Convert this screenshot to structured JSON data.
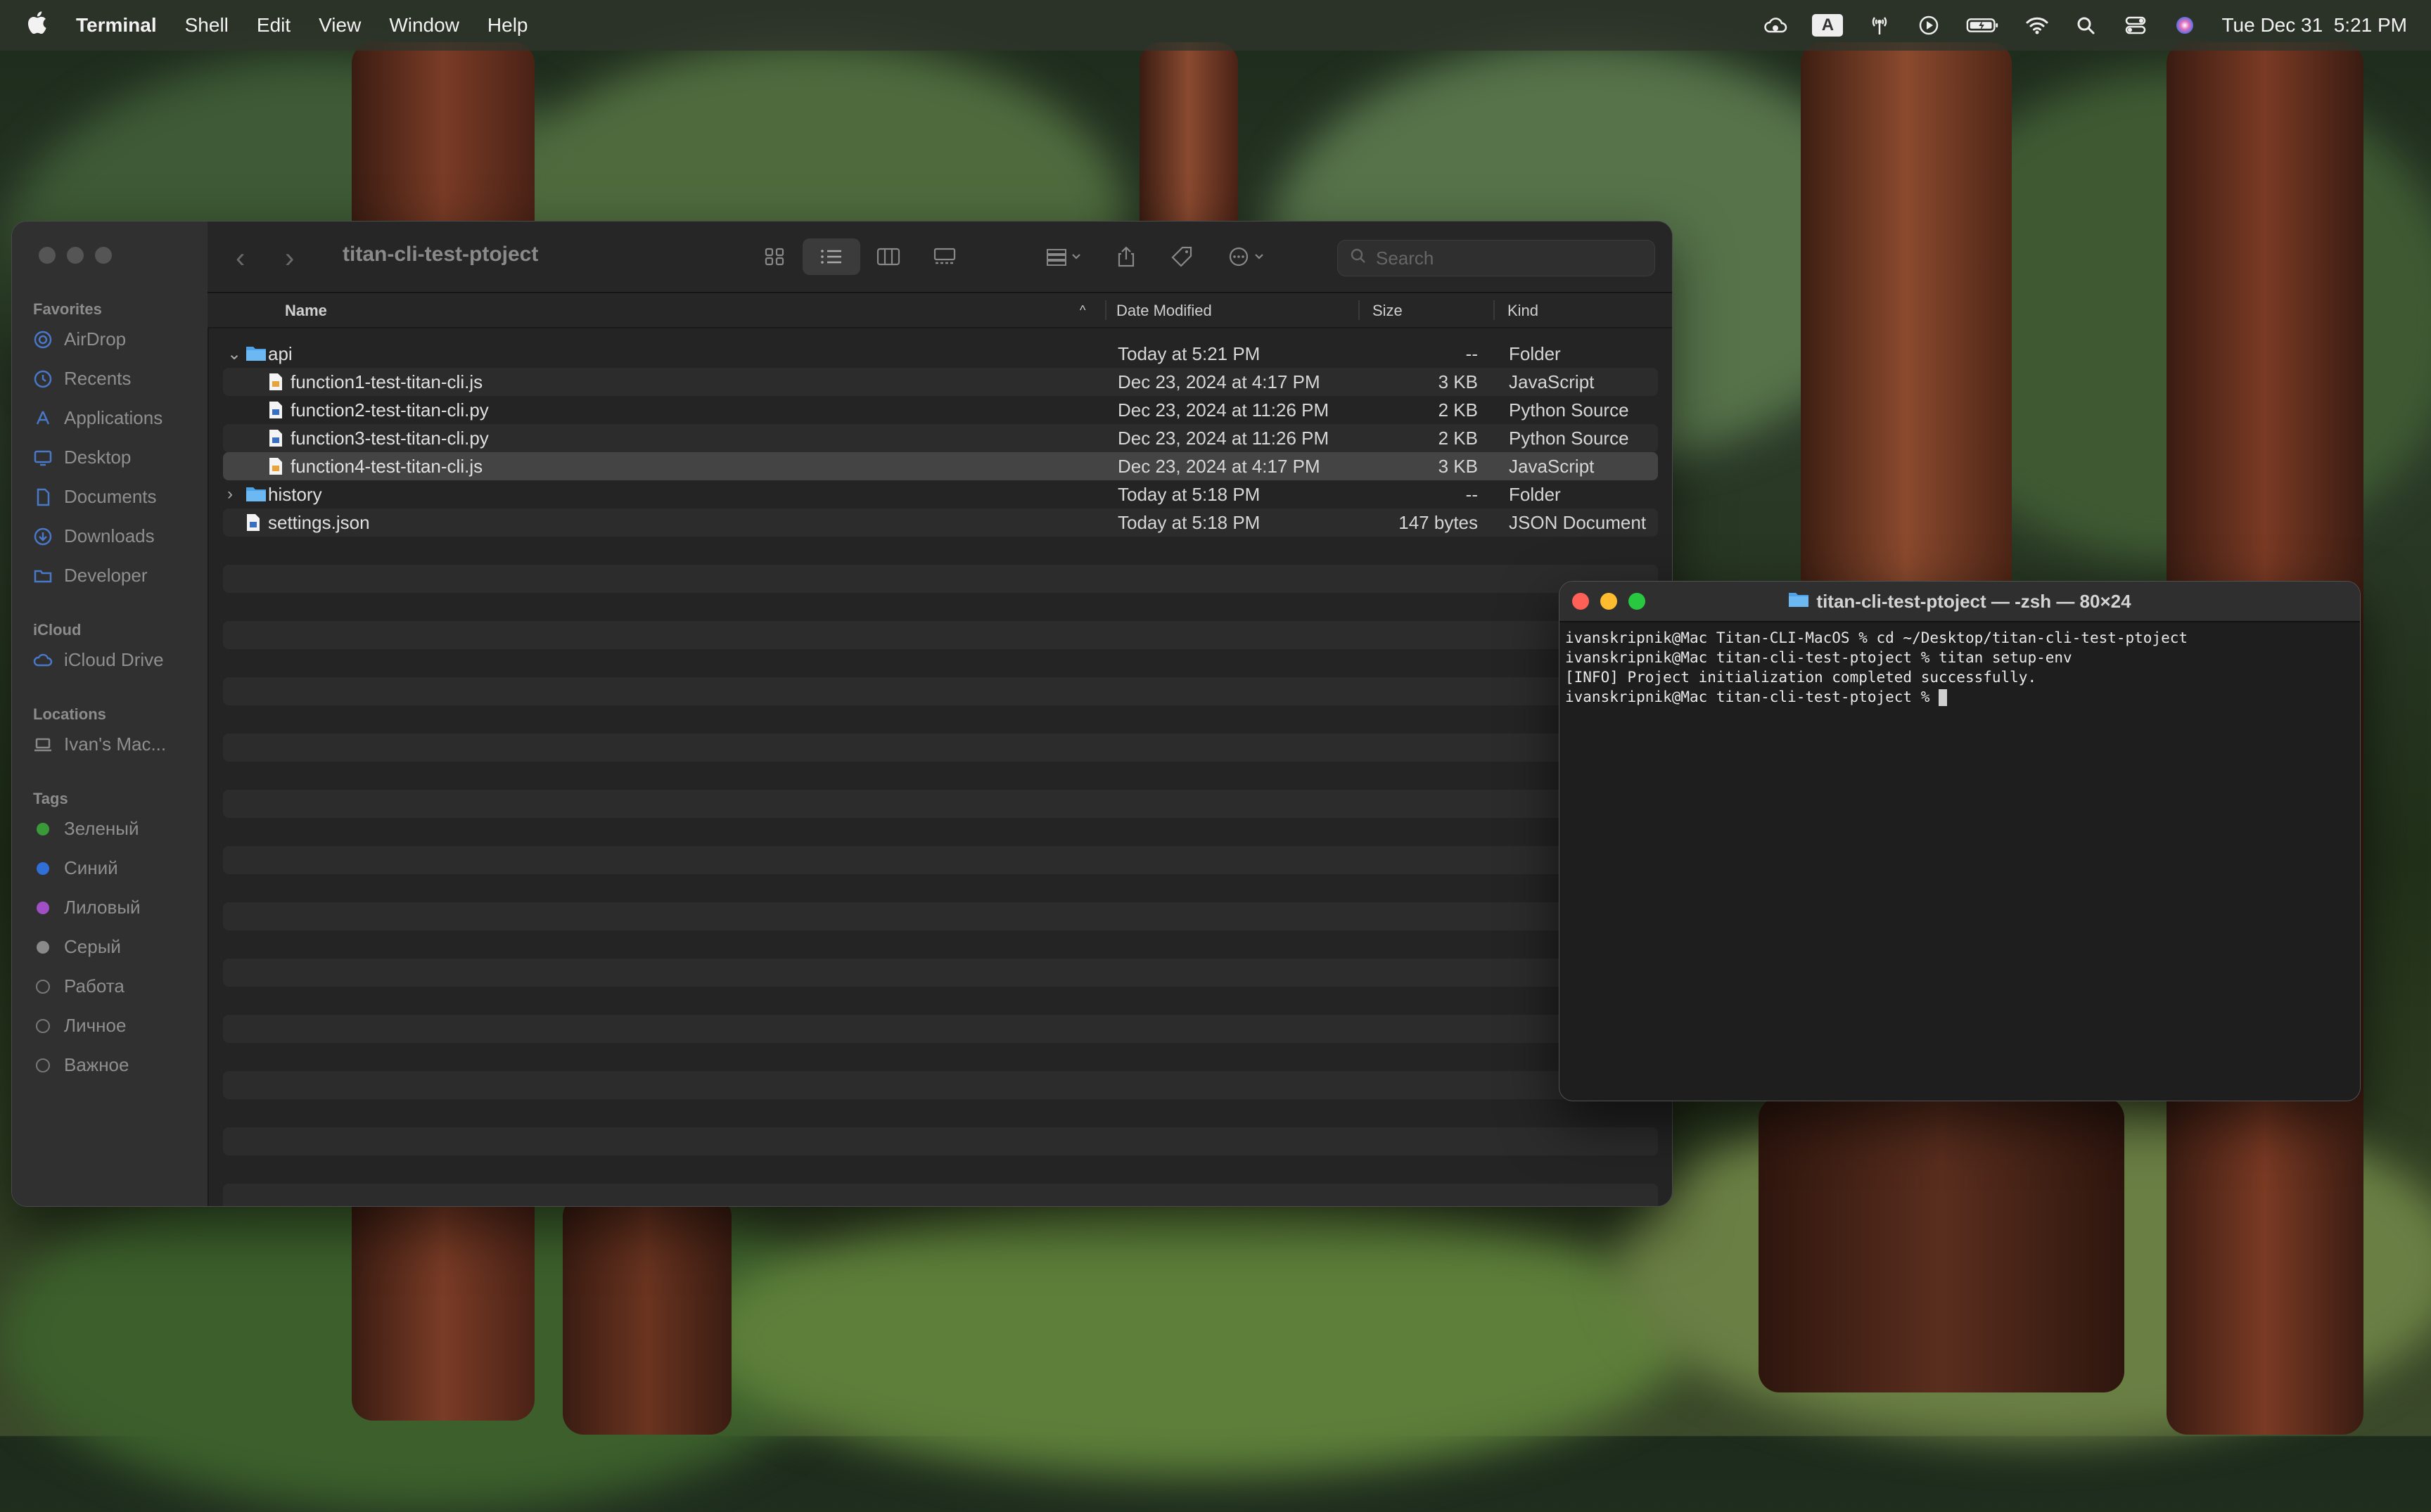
{
  "menubar": {
    "app_name": "Terminal",
    "menus": [
      "Shell",
      "Edit",
      "View",
      "Window",
      "Help"
    ],
    "input_source": "A",
    "clock": "Tue Dec 31  5:21 PM"
  },
  "finder": {
    "title": "titan-cli-test-ptoject",
    "search_placeholder": "Search",
    "sidebar": {
      "favorites_label": "Favorites",
      "favorites": [
        {
          "label": "AirDrop",
          "icon": "airdrop-icon"
        },
        {
          "label": "Recents",
          "icon": "clock-icon"
        },
        {
          "label": "Applications",
          "icon": "applications-icon"
        },
        {
          "label": "Desktop",
          "icon": "desktop-icon"
        },
        {
          "label": "Documents",
          "icon": "document-icon"
        },
        {
          "label": "Downloads",
          "icon": "download-icon"
        },
        {
          "label": "Developer",
          "icon": "folder-icon"
        }
      ],
      "icloud_label": "iCloud",
      "icloud": [
        {
          "label": "iCloud Drive",
          "icon": "cloud-icon"
        }
      ],
      "locations_label": "Locations",
      "locations": [
        {
          "label": "Ivan's Mac...",
          "icon": "laptop-icon"
        }
      ],
      "tags_label": "Tags",
      "tags": [
        {
          "label": "Зеленый",
          "color": "#3a9a3a"
        },
        {
          "label": "Синий",
          "color": "#2f6fd6"
        },
        {
          "label": "Лиловый",
          "color": "#a04fc4"
        },
        {
          "label": "Серый",
          "color": "#8a8a8a"
        },
        {
          "label": "Работа",
          "color": ""
        },
        {
          "label": "Личное",
          "color": ""
        },
        {
          "label": "Важное",
          "color": ""
        }
      ]
    },
    "columns": {
      "name": "Name",
      "date": "Date Modified",
      "size": "Size",
      "kind": "Kind"
    },
    "files": [
      {
        "name": "api",
        "date": "Today at 5:21 PM",
        "size": "--",
        "kind": "Folder",
        "type": "folder",
        "expanded": true,
        "depth": 0
      },
      {
        "name": "function1-test-titan-cli.js",
        "date": "Dec 23, 2024 at 4:17 PM",
        "size": "3 KB",
        "kind": "JavaScript",
        "type": "js",
        "depth": 1
      },
      {
        "name": "function2-test-titan-cli.py",
        "date": "Dec 23, 2024 at 11:26 PM",
        "size": "2 KB",
        "kind": "Python Source",
        "type": "py",
        "depth": 1
      },
      {
        "name": "function3-test-titan-cli.py",
        "date": "Dec 23, 2024 at 11:26 PM",
        "size": "2 KB",
        "kind": "Python Source",
        "type": "py",
        "depth": 1
      },
      {
        "name": "function4-test-titan-cli.js",
        "date": "Dec 23, 2024 at 4:17 PM",
        "size": "3 KB",
        "kind": "JavaScript",
        "type": "js",
        "depth": 1,
        "selected": true
      },
      {
        "name": "history",
        "date": "Today at 5:18 PM",
        "size": "--",
        "kind": "Folder",
        "type": "folder",
        "expanded": false,
        "depth": 0
      },
      {
        "name": "settings.json",
        "date": "Today at 5:18 PM",
        "size": "147 bytes",
        "kind": "JSON Document",
        "type": "json",
        "depth": 0
      }
    ]
  },
  "terminal": {
    "title": "titan-cli-test-ptoject — -zsh — 80×24",
    "lines": [
      "ivanskripnik@Mac Titan-CLI-MacOS % cd ~/Desktop/titan-cli-test-ptoject",
      "ivanskripnik@Mac titan-cli-test-ptoject % titan setup-env",
      "[INFO] Project initialization completed successfully.",
      "ivanskripnik@Mac titan-cli-test-ptoject % "
    ],
    "colors": {
      "close": "#fe5f57",
      "minimize": "#febc2e",
      "zoom": "#28c840"
    }
  }
}
